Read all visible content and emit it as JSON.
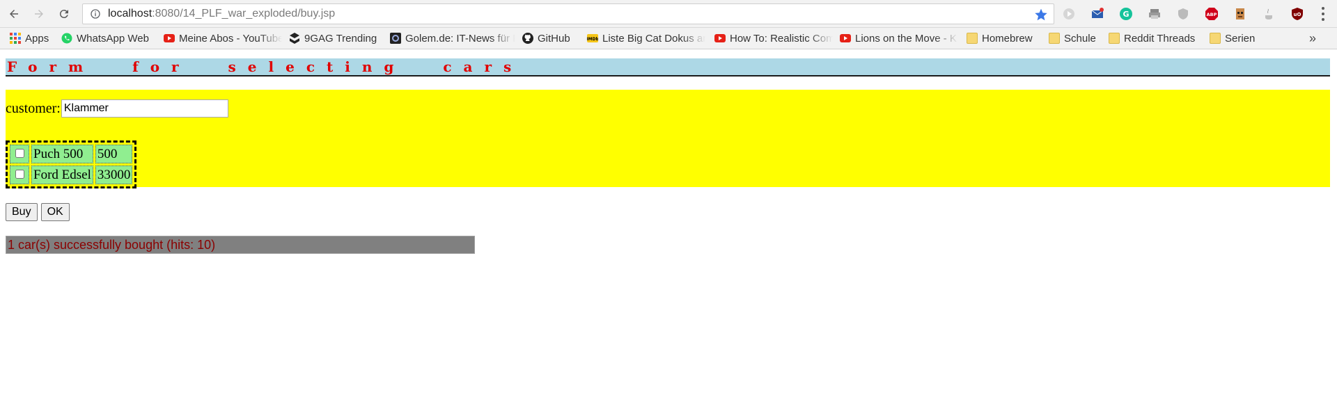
{
  "browser": {
    "url_host": "localhost",
    "url_rest": ":8080/14_PLF_war_exploded/buy.jsp",
    "bookmarks": [
      {
        "label": "Apps",
        "icon": "apps-grid-icon"
      },
      {
        "label": "WhatsApp Web",
        "icon": "whatsapp-icon"
      },
      {
        "label": "Meine Abos - YouTube",
        "icon": "youtube-icon"
      },
      {
        "label": "9GAG Trending",
        "icon": "9gag-icon"
      },
      {
        "label": "Golem.de: IT-News für Profis",
        "icon": "golem-icon"
      },
      {
        "label": "GitHub",
        "icon": "github-icon"
      },
      {
        "label": "Liste Big Cat Dokus an",
        "icon": "imdb-icon"
      },
      {
        "label": "How To: Realistic Com",
        "icon": "youtube-icon"
      },
      {
        "label": "Lions on the Move - K",
        "icon": "youtube-icon"
      },
      {
        "label": "Homebrew",
        "icon": "folder-icon"
      },
      {
        "label": "Schule",
        "icon": "folder-icon"
      },
      {
        "label": "Reddit Threads",
        "icon": "folder-icon"
      },
      {
        "label": "Serien",
        "icon": "folder-icon"
      }
    ],
    "more_label": "»"
  },
  "page": {
    "heading": "Form for selecting cars",
    "customer_label": "customer:",
    "customer_value": "Klammer",
    "cars": [
      {
        "name": "Puch 500",
        "price": "500",
        "checked": false
      },
      {
        "name": "Ford Edsel",
        "price": "33000",
        "checked": false
      }
    ],
    "buy_label": "Buy",
    "ok_label": "OK",
    "status": "1 car(s) successfully bought (hits: 10)"
  },
  "colors": {
    "heading_bg": "#add8e6",
    "heading_text": "#e00000",
    "form_bg": "#ffff00",
    "cell_bg": "#90ee90",
    "status_bg": "#808080",
    "status_text": "#8b0000"
  }
}
